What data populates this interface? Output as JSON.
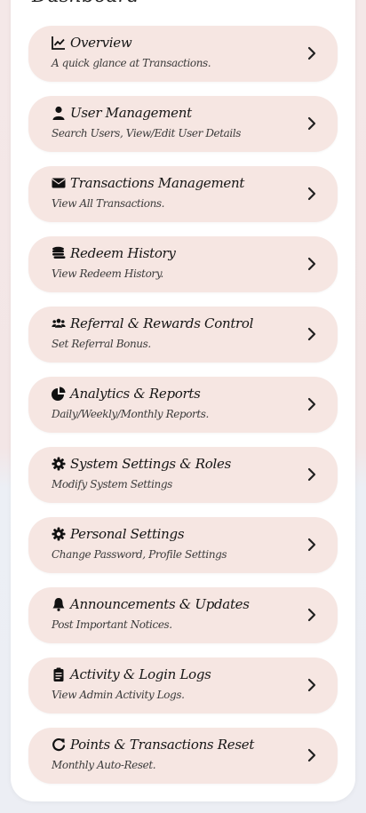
{
  "page": {
    "title": "Dashboard"
  },
  "menu": [
    {
      "id": "overview",
      "icon": "chart-line-icon",
      "title": "Overview",
      "description": "A quick glance at Transactions."
    },
    {
      "id": "user-management",
      "icon": "user-icon",
      "title": "User Management",
      "description": "Search Users, View/Edit User Details"
    },
    {
      "id": "transactions-management",
      "icon": "envelope-icon",
      "title": "Transactions Management",
      "description": "View All Transactions."
    },
    {
      "id": "redeem-history",
      "icon": "coins-icon",
      "title": "Redeem History",
      "description": "View Redeem History."
    },
    {
      "id": "referral-rewards",
      "icon": "users-icon",
      "title": "Referral & Rewards Control",
      "description": "Set Referral Bonus."
    },
    {
      "id": "analytics-reports",
      "icon": "pie-chart-icon",
      "title": "Analytics & Reports",
      "description": "Daily/Weekly/Monthly Reports."
    },
    {
      "id": "system-settings",
      "icon": "gear-icon",
      "title": "System Settings & Roles",
      "description": "Modify System Settings"
    },
    {
      "id": "personal-settings",
      "icon": "gear-icon",
      "title": "Personal Settings",
      "description": "Change Password, Profile Settings"
    },
    {
      "id": "announcements",
      "icon": "bell-icon",
      "title": "Announcements & Updates",
      "description": "Post Important Notices."
    },
    {
      "id": "activity-logs",
      "icon": "clipboard-icon",
      "title": "Activity & Login Logs",
      "description": "View Admin Activity Logs."
    },
    {
      "id": "points-reset",
      "icon": "redo-icon",
      "title": "Points & Transactions Reset",
      "description": "Monthly Auto-Reset."
    }
  ],
  "colors": {
    "card_bg": "#f6e6e2",
    "panel_bg": "#ffffff",
    "text": "#151515"
  }
}
